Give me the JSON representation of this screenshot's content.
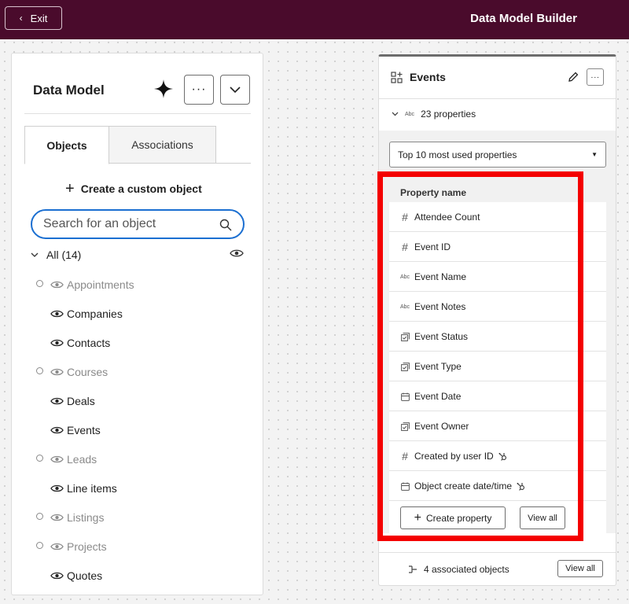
{
  "topbar": {
    "exit_label": "Exit",
    "title": "Data Model Builder"
  },
  "left_panel": {
    "title": "Data Model",
    "more_label": "···",
    "tabs": [
      {
        "label": "Objects",
        "active": true
      },
      {
        "label": "Associations",
        "active": false
      }
    ],
    "create_label": "Create a custom object",
    "search_placeholder": "Search for an object",
    "all_label": "All (14)",
    "objects": [
      {
        "label": "Appointments",
        "visible": false
      },
      {
        "label": "Companies",
        "visible": true
      },
      {
        "label": "Contacts",
        "visible": true
      },
      {
        "label": "Courses",
        "visible": false
      },
      {
        "label": "Deals",
        "visible": true
      },
      {
        "label": "Events",
        "visible": true
      },
      {
        "label": "Leads",
        "visible": false
      },
      {
        "label": "Line items",
        "visible": true
      },
      {
        "label": "Listings",
        "visible": false
      },
      {
        "label": "Projects",
        "visible": false
      },
      {
        "label": "Quotes",
        "visible": true
      }
    ]
  },
  "right_panel": {
    "title": "Events",
    "more_label": "···",
    "properties_count": "23 properties",
    "filter_selected": "Top 10 most used properties",
    "column_header": "Property name",
    "properties": [
      {
        "label": "Attendee Count",
        "type_icon": "number-icon"
      },
      {
        "label": "Event ID",
        "type_icon": "number-icon"
      },
      {
        "label": "Event Name",
        "type_icon": "text-icon"
      },
      {
        "label": "Event Notes",
        "type_icon": "text-icon"
      },
      {
        "label": "Event Status",
        "type_icon": "select-icon"
      },
      {
        "label": "Event Type",
        "type_icon": "select-icon"
      },
      {
        "label": "Event Date",
        "type_icon": "date-icon"
      },
      {
        "label": "Event Owner",
        "type_icon": "select-icon"
      },
      {
        "label": "Created by user ID",
        "type_icon": "number-icon",
        "hubspot": true
      },
      {
        "label": "Object create date/time",
        "type_icon": "date-icon",
        "hubspot": true
      }
    ],
    "create_property_label": "Create property",
    "view_all_label": "View all",
    "associated_label": "4 associated objects",
    "assoc_view_all_label": "View all"
  },
  "colors": {
    "topbar": "#4a0b2c",
    "search_border": "#1b6fd1",
    "highlight": "#f40000"
  }
}
